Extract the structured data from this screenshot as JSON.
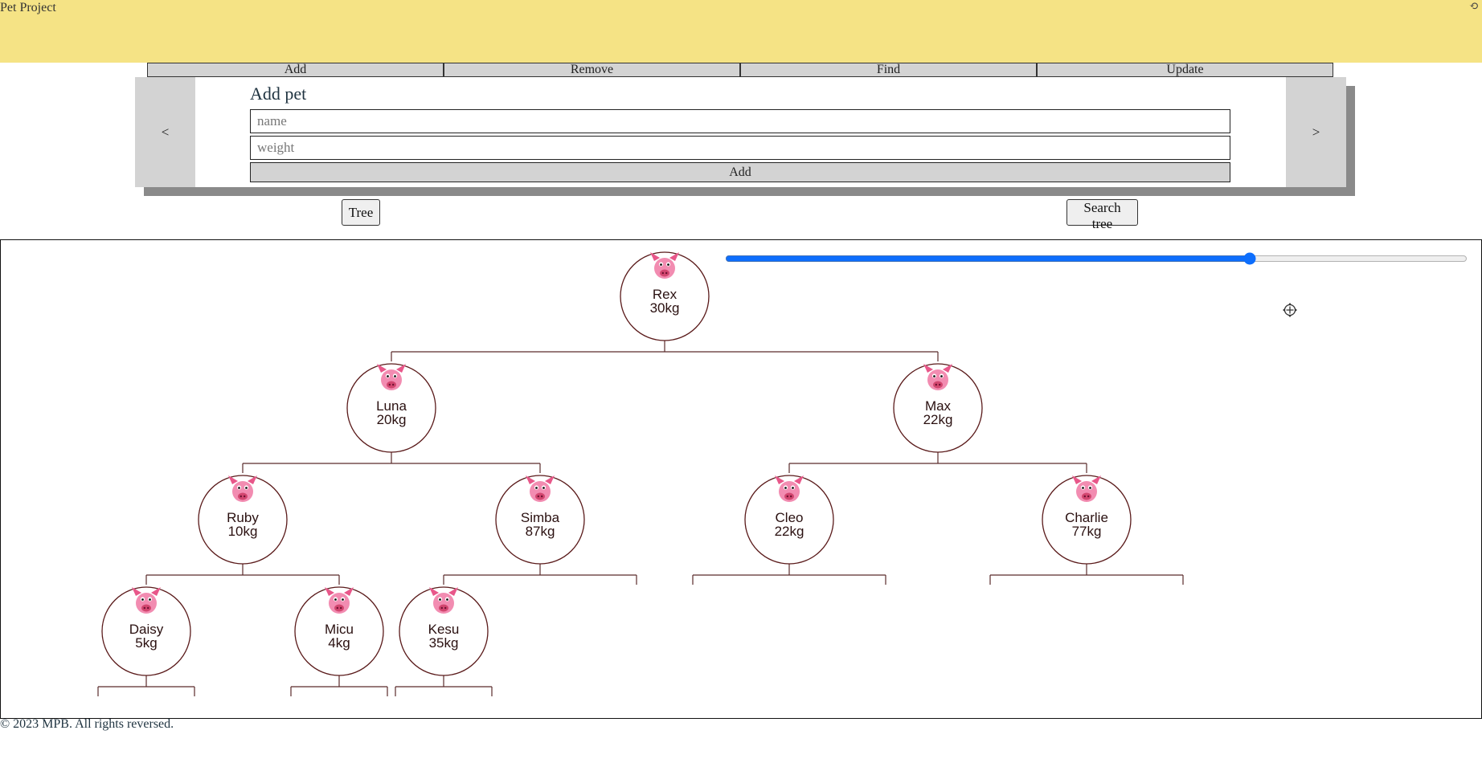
{
  "header": {
    "title": "Pet Project",
    "history_icon": "history-icon"
  },
  "menu": {
    "items": [
      "Add",
      "Remove",
      "Find",
      "Update"
    ]
  },
  "panel": {
    "prev_label": "<",
    "next_label": ">",
    "title": "Add pet",
    "name_placeholder": "name",
    "weight_placeholder": "weight",
    "submit_label": "Add"
  },
  "actions": {
    "tree_label": "Tree",
    "search_tree_label": "Search tree"
  },
  "zoom": {
    "value": 71,
    "min": 0,
    "max": 100
  },
  "tree": {
    "root": {
      "name": "Rex",
      "weight": "30kg",
      "children": [
        {
          "name": "Luna",
          "weight": "20kg",
          "children": [
            {
              "name": "Ruby",
              "weight": "10kg",
              "children": [
                {
                  "name": "Daisy",
                  "weight": "5kg",
                  "children": [
                    null,
                    null
                  ]
                },
                {
                  "name": "Micu",
                  "weight": "4kg",
                  "children": [
                    null,
                    null
                  ]
                }
              ]
            },
            {
              "name": "Simba",
              "weight": "87kg",
              "children": [
                {
                  "name": "Kesu",
                  "weight": "35kg",
                  "children": [
                    null,
                    null
                  ]
                },
                null
              ]
            }
          ]
        },
        {
          "name": "Max",
          "weight": "22kg",
          "children": [
            {
              "name": "Cleo",
              "weight": "22kg",
              "children": [
                null,
                null
              ]
            },
            {
              "name": "Charlie",
              "weight": "77kg",
              "children": [
                null,
                null
              ]
            }
          ]
        }
      ]
    },
    "node_icon": "pig-face-icon",
    "link_color": "#5a2a2a",
    "node_border_color": "#5a1a1a"
  },
  "footer": {
    "text": "© 2023 MPB. All rights reversed."
  }
}
